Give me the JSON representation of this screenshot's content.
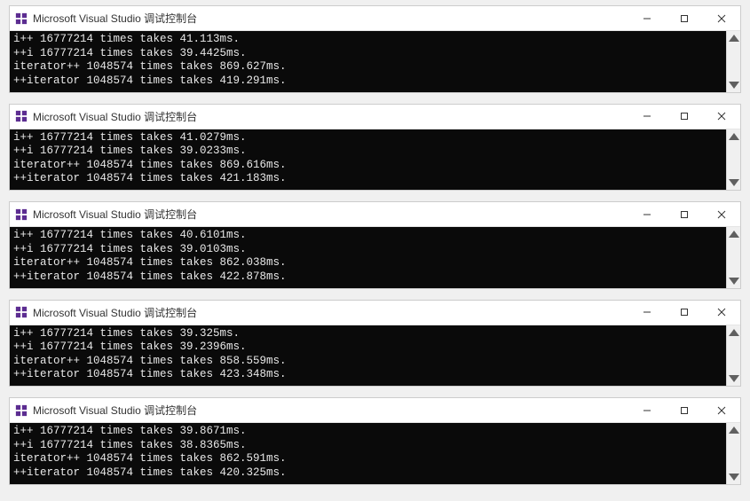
{
  "window_title": "Microsoft Visual Studio 调试控制台",
  "windows": [
    {
      "lines": [
        "i++ 16777214 times takes 41.113ms.",
        "++i 16777214 times takes 39.4425ms.",
        "iterator++ 1048574 times takes 869.627ms.",
        "++iterator 1048574 times takes 419.291ms."
      ]
    },
    {
      "lines": [
        "i++ 16777214 times takes 41.0279ms.",
        "++i 16777214 times takes 39.0233ms.",
        "iterator++ 1048574 times takes 869.616ms.",
        "++iterator 1048574 times takes 421.183ms."
      ]
    },
    {
      "lines": [
        "i++ 16777214 times takes 40.6101ms.",
        "++i 16777214 times takes 39.0103ms.",
        "iterator++ 1048574 times takes 862.038ms.",
        "++iterator 1048574 times takes 422.878ms."
      ]
    },
    {
      "lines": [
        "i++ 16777214 times takes 39.325ms.",
        "++i 16777214 times takes 39.2396ms.",
        "iterator++ 1048574 times takes 858.559ms.",
        "++iterator 1048574 times takes 423.348ms."
      ]
    },
    {
      "lines": [
        "i++ 16777214 times takes 39.8671ms.",
        "++i 16777214 times takes 38.8365ms.",
        "iterator++ 1048574 times takes 862.591ms.",
        "++iterator 1048574 times takes 420.325ms."
      ]
    }
  ]
}
